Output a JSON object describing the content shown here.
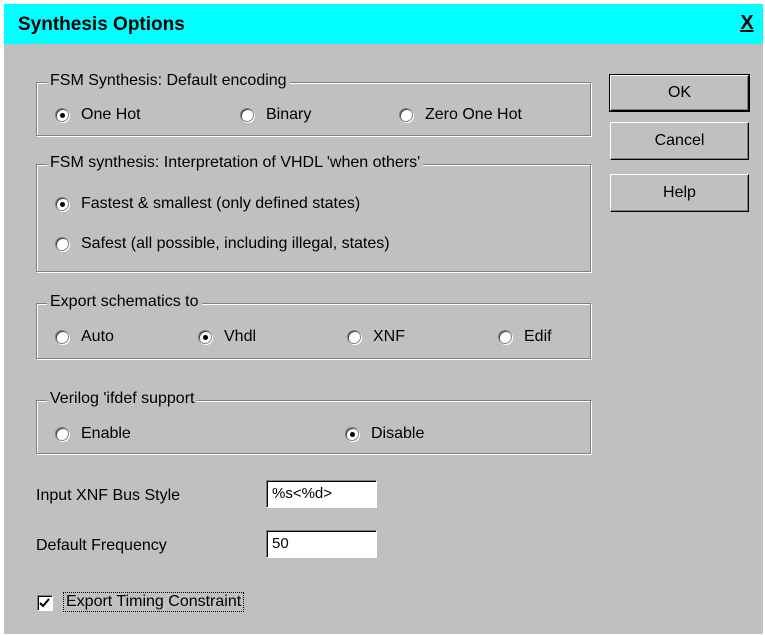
{
  "window": {
    "title": "Synthesis Options",
    "close_glyph": "X",
    "title_bar_color": "#00ffff"
  },
  "buttons": {
    "ok": "OK",
    "cancel": "Cancel",
    "help": "Help"
  },
  "fsm_encoding": {
    "legend": "FSM Synthesis: Default encoding",
    "options": [
      "One Hot",
      "Binary",
      "Zero One Hot"
    ],
    "selected": "One Hot"
  },
  "fsm_when_others": {
    "legend": "FSM synthesis: Interpretation of VHDL 'when others'",
    "options": [
      "Fastest & smallest (only defined states)",
      "Safest (all possible, including illegal, states)"
    ],
    "selected": "Fastest & smallest (only defined states)"
  },
  "export_schematics": {
    "legend": "Export schematics to",
    "options": [
      "Auto",
      "Vhdl",
      "XNF",
      "Edif"
    ],
    "selected": "Vhdl"
  },
  "verilog_ifdef": {
    "legend": "Verilog 'ifdef support",
    "options": [
      "Enable",
      "Disable"
    ],
    "selected": "Disable"
  },
  "input_xnf_bus_style": {
    "label": "Input XNF Bus Style",
    "value": "%s<%d>"
  },
  "default_frequency": {
    "label": "Default Frequency",
    "value": "50"
  },
  "export_timing": {
    "label": "Export Timing Constraint",
    "checked": true
  }
}
